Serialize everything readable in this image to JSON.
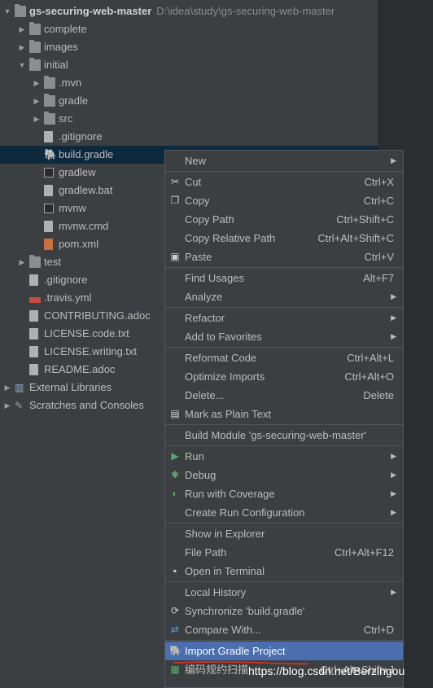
{
  "project": {
    "root": "gs-securing-web-master",
    "root_path": "D:\\idea\\study\\gs-securing-web-master",
    "items": [
      {
        "label": "complete",
        "icon": "folder-icon"
      },
      {
        "label": "images",
        "icon": "folder-icon"
      },
      {
        "label": "initial",
        "icon": "folder-icon"
      },
      {
        "label": ".mvn",
        "icon": "folder-icon"
      },
      {
        "label": "gradle",
        "icon": "folder-icon"
      },
      {
        "label": "src",
        "icon": "folder-icon"
      },
      {
        "label": ".gitignore",
        "icon": "gitignore-file-icon"
      },
      {
        "label": "build.gradle",
        "icon": "gradle-elephant-icon"
      },
      {
        "label": "gradlew",
        "icon": "terminal-file-icon"
      },
      {
        "label": "gradlew.bat",
        "icon": "text-file-icon"
      },
      {
        "label": "mvnw",
        "icon": "terminal-file-icon"
      },
      {
        "label": "mvnw.cmd",
        "icon": "text-file-icon"
      },
      {
        "label": "pom.xml",
        "icon": "maven-file-icon"
      },
      {
        "label": "test",
        "icon": "folder-icon"
      },
      {
        "label": ".gitignore",
        "icon": "gitignore-file-icon"
      },
      {
        "label": ".travis.yml",
        "icon": "yml-file-icon"
      },
      {
        "label": "CONTRIBUTING.adoc",
        "icon": "text-file-icon"
      },
      {
        "label": "LICENSE.code.txt",
        "icon": "text-file-icon"
      },
      {
        "label": "LICENSE.writing.txt",
        "icon": "text-file-icon"
      },
      {
        "label": "README.adoc",
        "icon": "text-file-icon"
      },
      {
        "label": "External Libraries",
        "icon": "libraries-icon"
      },
      {
        "label": "Scratches and Consoles",
        "icon": "scratches-icon"
      }
    ]
  },
  "menu": {
    "items": [
      {
        "label": "New",
        "shortcut": "",
        "submenu": true,
        "icon": ""
      },
      {
        "label": "Cut",
        "shortcut": "Ctrl+X",
        "submenu": false,
        "icon": "scissors-icon"
      },
      {
        "label": "Copy",
        "shortcut": "Ctrl+C",
        "submenu": false,
        "icon": "copy-icon"
      },
      {
        "label": "Copy Path",
        "shortcut": "Ctrl+Shift+C",
        "submenu": false,
        "icon": ""
      },
      {
        "label": "Copy Relative Path",
        "shortcut": "Ctrl+Alt+Shift+C",
        "submenu": false,
        "icon": ""
      },
      {
        "label": "Paste",
        "shortcut": "Ctrl+V",
        "submenu": false,
        "icon": "paste-icon"
      },
      {
        "label": "Find Usages",
        "shortcut": "Alt+F7",
        "submenu": false,
        "icon": ""
      },
      {
        "label": "Analyze",
        "shortcut": "",
        "submenu": true,
        "icon": ""
      },
      {
        "label": "Refactor",
        "shortcut": "",
        "submenu": true,
        "icon": ""
      },
      {
        "label": "Add to Favorites",
        "shortcut": "",
        "submenu": true,
        "icon": ""
      },
      {
        "label": "Reformat Code",
        "shortcut": "Ctrl+Alt+L",
        "submenu": false,
        "icon": ""
      },
      {
        "label": "Optimize Imports",
        "shortcut": "Ctrl+Alt+O",
        "submenu": false,
        "icon": ""
      },
      {
        "label": "Delete...",
        "shortcut": "Delete",
        "submenu": false,
        "icon": ""
      },
      {
        "label": "Mark as Plain Text",
        "shortcut": "",
        "submenu": false,
        "icon": "plain-text-icon"
      },
      {
        "label": "Build Module 'gs-securing-web-master'",
        "shortcut": "",
        "submenu": false,
        "icon": ""
      },
      {
        "label": "Run",
        "shortcut": "",
        "submenu": true,
        "icon": "run-icon"
      },
      {
        "label": "Debug",
        "shortcut": "",
        "submenu": true,
        "icon": "debug-icon"
      },
      {
        "label": "Run with Coverage",
        "shortcut": "",
        "submenu": true,
        "icon": "coverage-icon"
      },
      {
        "label": "Create Run Configuration",
        "shortcut": "",
        "submenu": true,
        "icon": ""
      },
      {
        "label": "Show in Explorer",
        "shortcut": "",
        "submenu": false,
        "icon": ""
      },
      {
        "label": "File Path",
        "shortcut": "Ctrl+Alt+F12",
        "submenu": false,
        "icon": ""
      },
      {
        "label": "Open in Terminal",
        "shortcut": "",
        "submenu": false,
        "icon": "terminal-icon"
      },
      {
        "label": "Local History",
        "shortcut": "",
        "submenu": true,
        "icon": ""
      },
      {
        "label": "Synchronize 'build.gradle'",
        "shortcut": "",
        "submenu": false,
        "icon": "sync-icon"
      },
      {
        "label": "Compare With...",
        "shortcut": "Ctrl+D",
        "submenu": false,
        "icon": "compare-icon"
      },
      {
        "label": "Import Gradle Project",
        "shortcut": "",
        "submenu": false,
        "icon": "gradle-elephant-icon"
      },
      {
        "label": "编码规约扫描",
        "shortcut": "Ctrl+Alt+Shift+J",
        "submenu": false,
        "icon": "code-scan-icon"
      }
    ]
  },
  "watermark": "https://blog.csdn.net/Berzingou",
  "colors": {
    "menu_highlight": "#4b6eaf",
    "selected_row": "#0d293e",
    "run_green": "#59a869",
    "annotation_red": "#e0301e"
  }
}
